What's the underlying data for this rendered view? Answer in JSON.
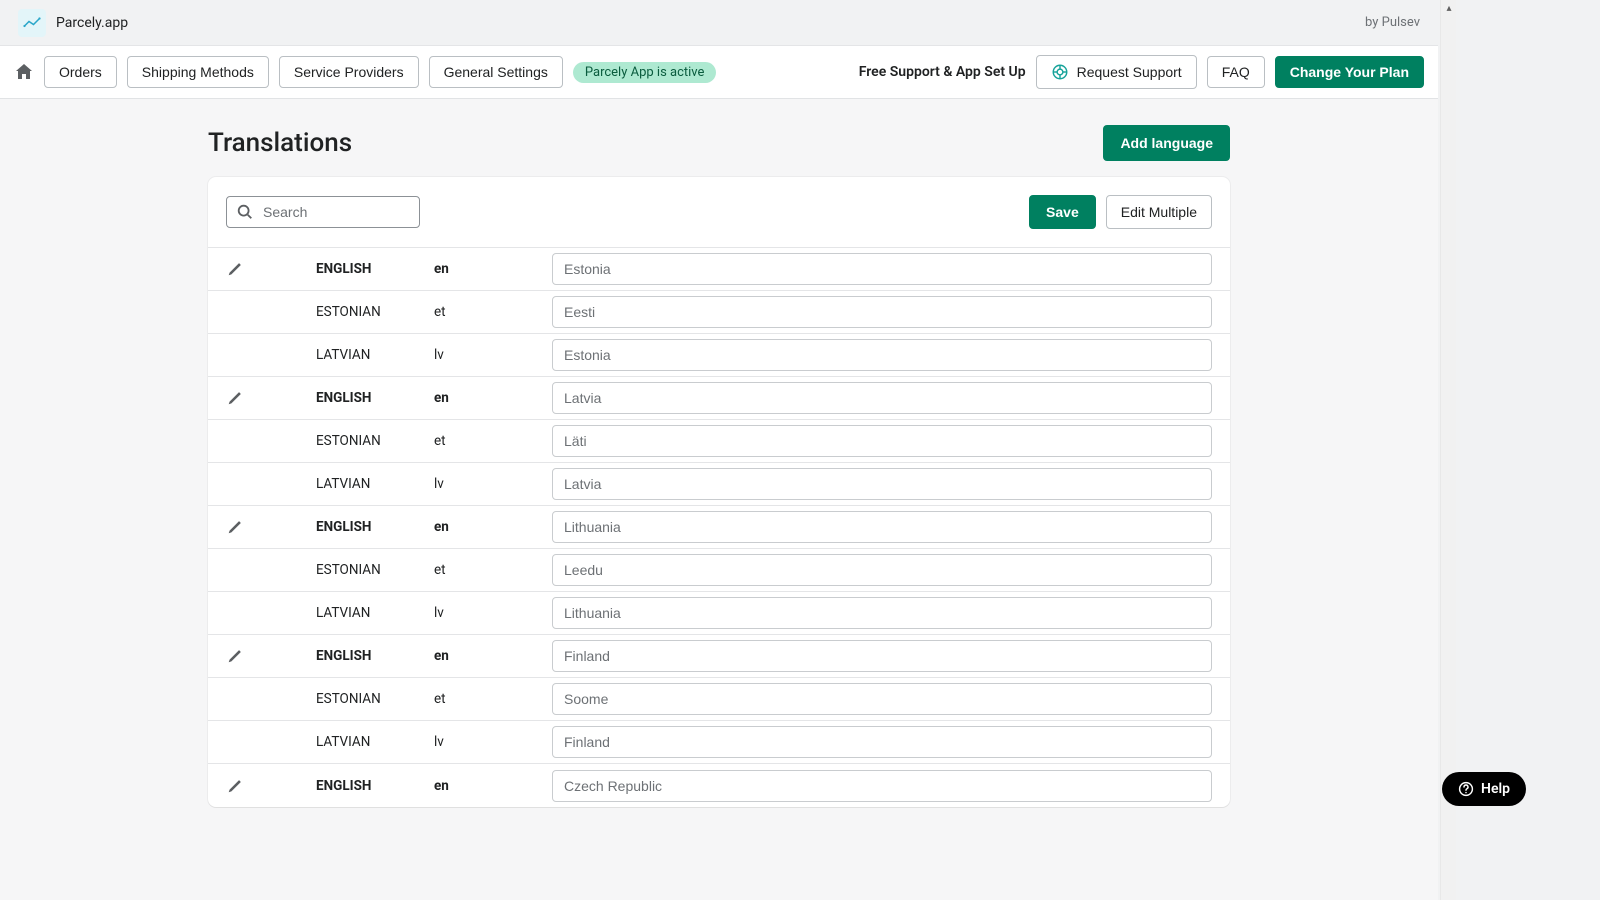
{
  "app": {
    "title": "Parcely.app",
    "byline": "by Pulsev"
  },
  "nav": {
    "orders": "Orders",
    "shipping_methods": "Shipping Methods",
    "service_providers": "Service Providers",
    "general_settings": "General Settings",
    "status_pill": "Parcely App is active",
    "support_text": "Free Support & App Set Up",
    "request_support": "Request Support",
    "faq": "FAQ",
    "change_plan": "Change Your Plan"
  },
  "page": {
    "title": "Translations",
    "add_language": "Add language"
  },
  "toolbar": {
    "search_placeholder": "Search",
    "save": "Save",
    "edit_multiple": "Edit Multiple"
  },
  "help": {
    "label": "Help"
  },
  "rows": [
    {
      "head": true,
      "lang": "ENGLISH",
      "code": "en",
      "value": "Estonia"
    },
    {
      "head": false,
      "lang": "ESTONIAN",
      "code": "et",
      "value": "Eesti"
    },
    {
      "head": false,
      "lang": "LATVIAN",
      "code": "lv",
      "value": "Estonia"
    },
    {
      "head": true,
      "lang": "ENGLISH",
      "code": "en",
      "value": "Latvia"
    },
    {
      "head": false,
      "lang": "ESTONIAN",
      "code": "et",
      "value": "Läti"
    },
    {
      "head": false,
      "lang": "LATVIAN",
      "code": "lv",
      "value": "Latvia"
    },
    {
      "head": true,
      "lang": "ENGLISH",
      "code": "en",
      "value": "Lithuania"
    },
    {
      "head": false,
      "lang": "ESTONIAN",
      "code": "et",
      "value": "Leedu"
    },
    {
      "head": false,
      "lang": "LATVIAN",
      "code": "lv",
      "value": "Lithuania"
    },
    {
      "head": true,
      "lang": "ENGLISH",
      "code": "en",
      "value": "Finland"
    },
    {
      "head": false,
      "lang": "ESTONIAN",
      "code": "et",
      "value": "Soome"
    },
    {
      "head": false,
      "lang": "LATVIAN",
      "code": "lv",
      "value": "Finland"
    },
    {
      "head": true,
      "lang": "ENGLISH",
      "code": "en",
      "value": "Czech Republic"
    }
  ]
}
